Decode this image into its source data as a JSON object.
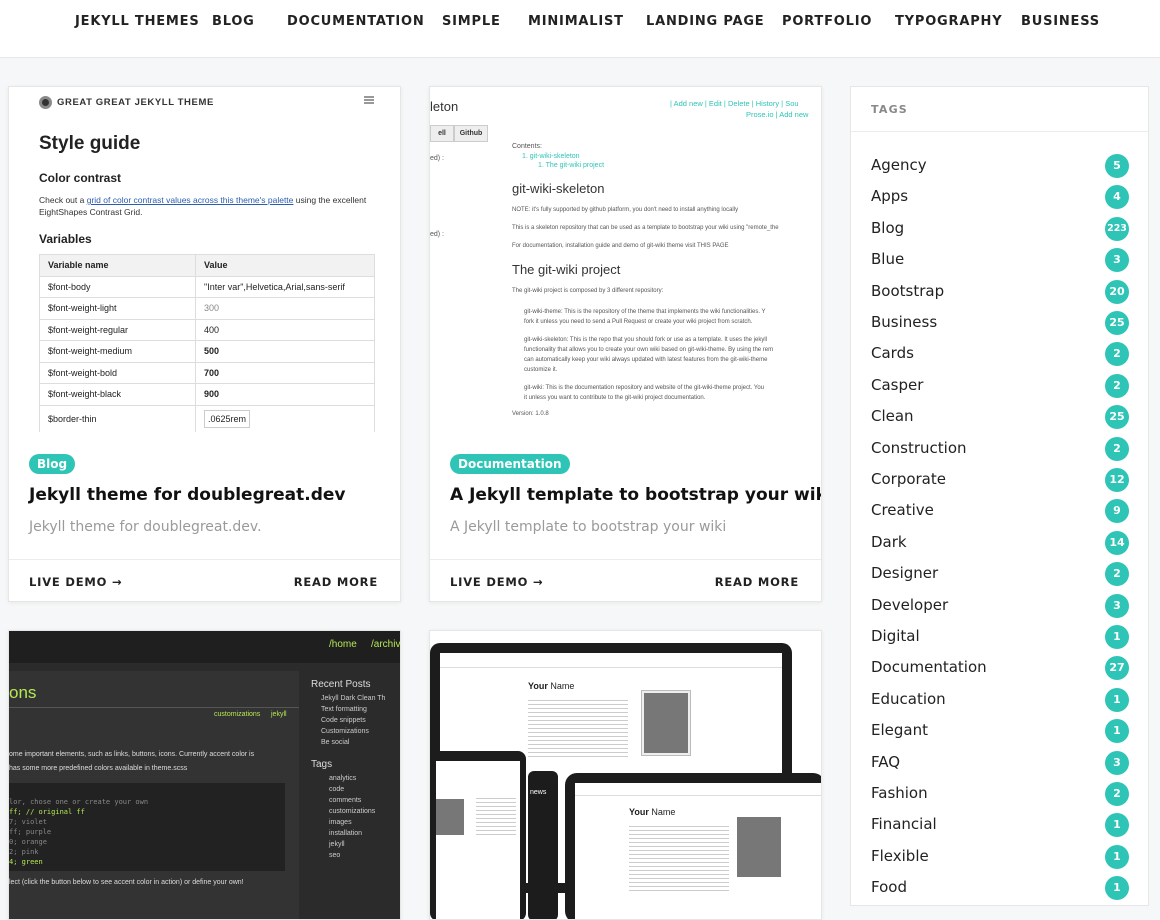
{
  "nav": {
    "items": [
      "JEKYLL THEMES",
      "BLOG",
      "DOCUMENTATION",
      "SIMPLE",
      "MINIMALIST",
      "LANDING PAGE",
      "PORTFOLIO",
      "TYPOGRAPHY",
      "BUSINESS"
    ]
  },
  "cards": [
    {
      "badge": "Blog",
      "title": "Jekyll theme for doublegreat.dev",
      "description": "Jekyll theme for doublegreat.dev.",
      "live_demo": "LIVE DEMO →",
      "read_more": "READ MORE",
      "thumb": {
        "brand": "GREAT GREAT JEKYLL THEME",
        "heading": "Style guide",
        "sub1": "Color contrast",
        "p_pre": "Check out a ",
        "p_link": "grid of color contrast values across this theme's palette",
        "p_post": " using the excellent EightShapes Contrast Grid.",
        "sub2": "Variables",
        "col1": "Variable name",
        "col2": "Value",
        "rows": [
          [
            "$font-body",
            "\"Inter var\",Helvetica,Arial,sans-serif"
          ],
          [
            "$font-weight-light",
            "300"
          ],
          [
            "$font-weight-regular",
            "400"
          ],
          [
            "$font-weight-medium",
            "500"
          ],
          [
            "$font-weight-bold",
            "700"
          ],
          [
            "$font-weight-black",
            "900"
          ],
          [
            "$border-thin",
            ".0625rem"
          ]
        ]
      }
    },
    {
      "badge": "Documentation",
      "title": "A Jekyll template to bootstrap your wiki",
      "description": "A Jekyll template to bootstrap your wiki",
      "live_demo": "LIVE DEMO →",
      "read_more": "READ MORE",
      "thumb": {
        "title_left": "leton",
        "toolbar": "| Add new | Edit | Delete | History | Sou",
        "toolbar2": "Prose.io | Add new",
        "tab1": "ell",
        "tab2": "Github",
        "contents": "Contents:",
        "toc1": "1.  git-wiki-skeleton",
        "toc2": "1. The git-wiki project",
        "h1": "git-wiki-skeleton",
        "note": "NOTE: it's fully supported by github platform, you don't need to install anything locally",
        "line2": "This is a skeleton repository that can be used as a template to bootstrap your wiki using \"remote_the",
        "line3": "For documentation, installation guide and demo of git-wiki theme visit THIS PAGE",
        "h2": "The git-wiki project",
        "line4": "The git-wiki project is composed by 3 different repository:",
        "b1": "git-wiki-theme: This is the repository of the theme that implements the wiki functionalities. Y",
        "b1b": "fork it unless you need to send a Pull Request or create your wiki project from scratch.",
        "b2": "git-wiki-skeleton: This is the repo that you should fork or use as a template. It uses the jekyll",
        "b2b": "functionality that allows you to create your own wiki based on git-wiki-theme. By using the rem",
        "b2c": "can automatically keep your wiki always updated with latest features from the git-wiki-theme",
        "b2d": "customize it.",
        "b3": "git-wiki: This is the documentation repository and website of the git-wiki-theme project. You",
        "b3b": "it unless you want to contribute to the git-wiki project documentation.",
        "version": "Version: 1.0.8",
        "side1": "ed) :",
        "side2": "ed) :"
      }
    },
    {
      "thumb": {
        "crumb1": "/home",
        "crumb2": "/archiv",
        "heading": "ons",
        "meta1": "customizations",
        "meta2": "jekyll",
        "recent": "Recent Posts",
        "posts": [
          "Jekyll Dark Clean Th",
          "Text formatting",
          "Code snippets",
          "Customizations",
          "Be social"
        ],
        "tags_h": "Tags",
        "tags": [
          "analytics",
          "code",
          "comments",
          "customizations",
          "images",
          "installation",
          "jekyll",
          "seo"
        ],
        "body1": "ome important elements, such as links, buttons, icons. Currently accent color is",
        "body2": "has some more predefined colors available in theme.scss",
        "foot": "lect (click the button below to see accent color in action) or define your own!",
        "code": [
          "lor, chose one or create your own",
          "ff;     // original ff",
          "7;      violet",
          "ff;     purple",
          "0;      orange",
          "2;      pink",
          "4;      green"
        ]
      }
    },
    {
      "thumb": {
        "name_a": "Your",
        "name_b": "Name",
        "news": "news",
        "name2_a": "Your",
        "name2_b": "Name"
      }
    }
  ],
  "sidebar": {
    "heading": "TAGS",
    "tags": [
      {
        "name": "Agency",
        "count": "5"
      },
      {
        "name": "Apps",
        "count": "4"
      },
      {
        "name": "Blog",
        "count": "223"
      },
      {
        "name": "Blue",
        "count": "3"
      },
      {
        "name": "Bootstrap",
        "count": "20"
      },
      {
        "name": "Business",
        "count": "25"
      },
      {
        "name": "Cards",
        "count": "2"
      },
      {
        "name": "Casper",
        "count": "2"
      },
      {
        "name": "Clean",
        "count": "25"
      },
      {
        "name": "Construction",
        "count": "2"
      },
      {
        "name": "Corporate",
        "count": "12"
      },
      {
        "name": "Creative",
        "count": "9"
      },
      {
        "name": "Dark",
        "count": "14"
      },
      {
        "name": "Designer",
        "count": "2"
      },
      {
        "name": "Developer",
        "count": "3"
      },
      {
        "name": "Digital",
        "count": "1"
      },
      {
        "name": "Documentation",
        "count": "27"
      },
      {
        "name": "Education",
        "count": "1"
      },
      {
        "name": "Elegant",
        "count": "1"
      },
      {
        "name": "FAQ",
        "count": "3"
      },
      {
        "name": "Fashion",
        "count": "2"
      },
      {
        "name": "Financial",
        "count": "1"
      },
      {
        "name": "Flexible",
        "count": "1"
      },
      {
        "name": "Food",
        "count": "1"
      }
    ]
  },
  "colors": {
    "accent": "#2ec4b6",
    "text": "#222222",
    "muted": "#9a9a9a"
  }
}
